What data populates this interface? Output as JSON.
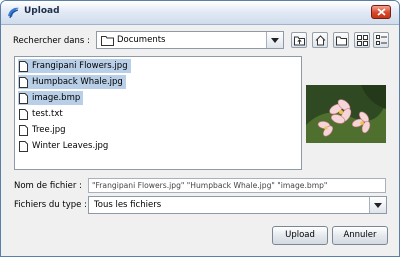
{
  "window": {
    "title": "Upload"
  },
  "toolbar": {
    "look_in_label": "Rechercher dans :",
    "look_in_value": "Documents",
    "buttons": [
      "up-one-level-icon",
      "home-icon",
      "new-folder-icon",
      "list-view-icon",
      "details-view-icon"
    ]
  },
  "file_list": {
    "items": [
      {
        "name": "Frangipani Flowers.jpg",
        "selected": true
      },
      {
        "name": "Humpback Whale.jpg",
        "selected": true
      },
      {
        "name": "image.bmp",
        "selected": true
      },
      {
        "name": "test.txt",
        "selected": false
      },
      {
        "name": "Tree.jpg",
        "selected": false
      },
      {
        "name": "Winter Leaves.jpg",
        "selected": false
      }
    ]
  },
  "preview": {
    "subject": "frangipani-flowers-thumbnail"
  },
  "filename": {
    "label": "Nom de fichier :",
    "value": "\"Frangipani Flowers.jpg\" \"Humpback Whale.jpg\" \"image.bmp\""
  },
  "filetype": {
    "label": "Fichiers du type :",
    "value": "Tous les fichiers"
  },
  "actions": {
    "upload_label": "Upload",
    "cancel_label": "Annuler"
  },
  "colors": {
    "selection": "#b9cfe7",
    "title_accent": "#1f2f4a",
    "close_button": "#d8472c"
  }
}
